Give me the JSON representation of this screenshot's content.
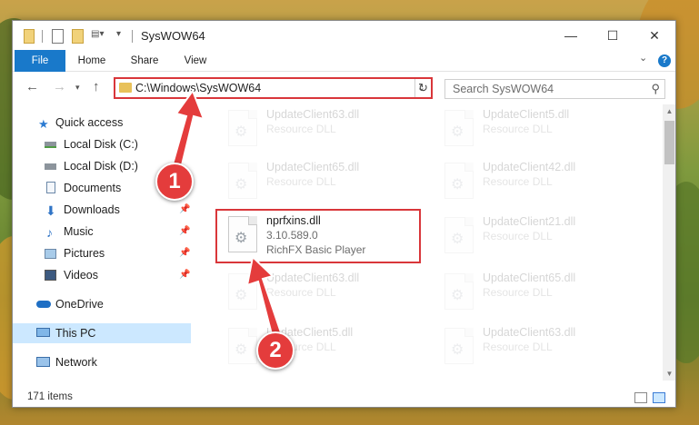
{
  "window": {
    "title": "SysWOW64",
    "controls": {
      "minimize": "—",
      "maximize": "☐",
      "close": "✕"
    }
  },
  "ribbon": {
    "tabs": [
      "File",
      "Home",
      "Share",
      "View"
    ],
    "help": "?"
  },
  "address": {
    "path": "C:\\Windows\\SysWOW64",
    "search_placeholder": "Search SysWOW64"
  },
  "navigation": {
    "items": [
      {
        "label": "Quick access",
        "icon": "star-icon",
        "pinned": false
      },
      {
        "label": "Local Disk (C:)",
        "icon": "drive-icon",
        "pinned": false
      },
      {
        "label": "Local Disk (D:)",
        "icon": "drive-icon",
        "pinned": false
      },
      {
        "label": "Documents",
        "icon": "documents-icon",
        "pinned": false
      },
      {
        "label": "Downloads",
        "icon": "download-icon",
        "pinned": true
      },
      {
        "label": "Music",
        "icon": "music-icon",
        "pinned": true
      },
      {
        "label": "Pictures",
        "icon": "pictures-icon",
        "pinned": true
      },
      {
        "label": "Videos",
        "icon": "videos-icon",
        "pinned": true
      },
      {
        "label": "OneDrive",
        "icon": "cloud-icon",
        "pinned": false
      },
      {
        "label": "This PC",
        "icon": "computer-icon",
        "pinned": false,
        "selected": true
      },
      {
        "label": "Network",
        "icon": "network-icon",
        "pinned": false
      }
    ]
  },
  "files": {
    "left": [
      {
        "name": "UpdateClient63.dll",
        "type": "Resource DLL"
      },
      {
        "name": "UpdateClient65.dll",
        "type": "Resource DLL"
      },
      {
        "name": "nprfxins.dll",
        "version": "3.10.589.0",
        "description": "RichFX Basic Player",
        "highlighted": true
      },
      {
        "name": "UpdateClient63.dll",
        "type": "Resource DLL"
      },
      {
        "name": "UpdateClient5.dll",
        "type": "Resource DLL"
      }
    ],
    "right": [
      {
        "name": "UpdateClient5.dll",
        "type": "Resource DLL"
      },
      {
        "name": "UpdateClient42.dll",
        "type": "Resource DLL"
      },
      {
        "name": "UpdateClient21.dll",
        "type": "Resource DLL"
      },
      {
        "name": "UpdateClient65.dll",
        "type": "Resource DLL"
      },
      {
        "name": "UpdateClient63.dll",
        "type": "Resource DLL"
      }
    ]
  },
  "status": {
    "item_count": "171 items"
  },
  "annotations": {
    "step1": "1",
    "step2": "2",
    "accent": "#e43c3c"
  }
}
